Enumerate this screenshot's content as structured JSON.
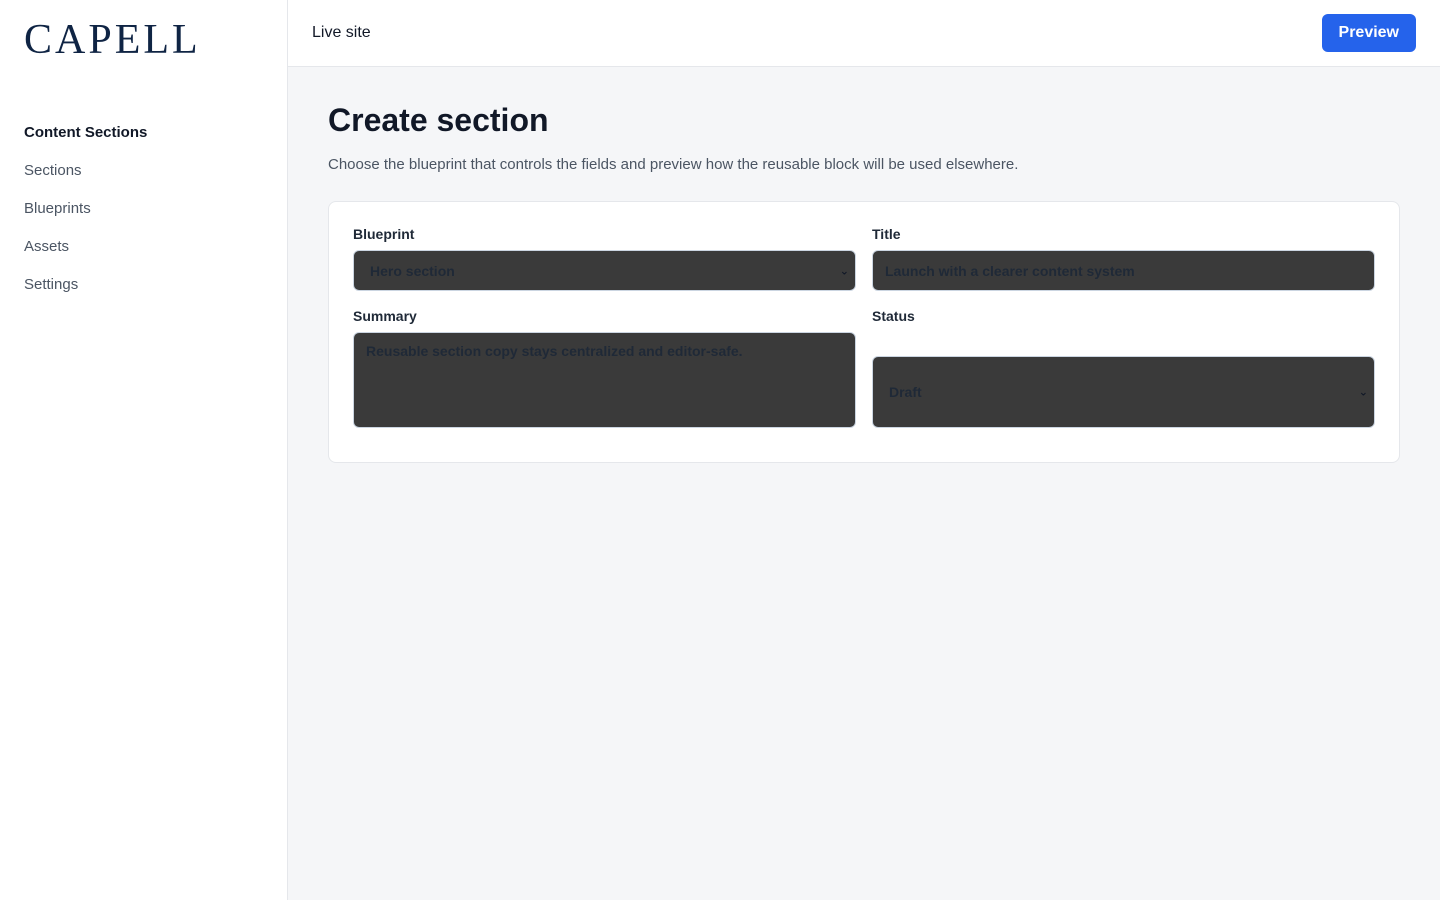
{
  "brand": {
    "logo": "CAPELL"
  },
  "sidebar": {
    "group_title": "Content Sections",
    "items": [
      {
        "label": "Sections"
      },
      {
        "label": "Blueprints"
      },
      {
        "label": "Assets"
      },
      {
        "label": "Settings"
      }
    ]
  },
  "topbar": {
    "live_site_label": "Live site",
    "preview_label": "Preview",
    "accent_color": "#2563eb"
  },
  "page": {
    "title": "Create section",
    "description": "Choose the blueprint that controls the fields and preview how the reusable block will be used elsewhere."
  },
  "form": {
    "blueprint": {
      "label": "Blueprint",
      "value": "Hero section"
    },
    "title": {
      "label": "Title",
      "value": "Launch with a clearer content system"
    },
    "summary": {
      "label": "Summary",
      "value": "Reusable section copy stays centralized and editor-safe."
    },
    "status": {
      "label": "Status",
      "value": "Draft"
    }
  },
  "icons": {
    "select_chevron": "chevron-down-icon"
  }
}
